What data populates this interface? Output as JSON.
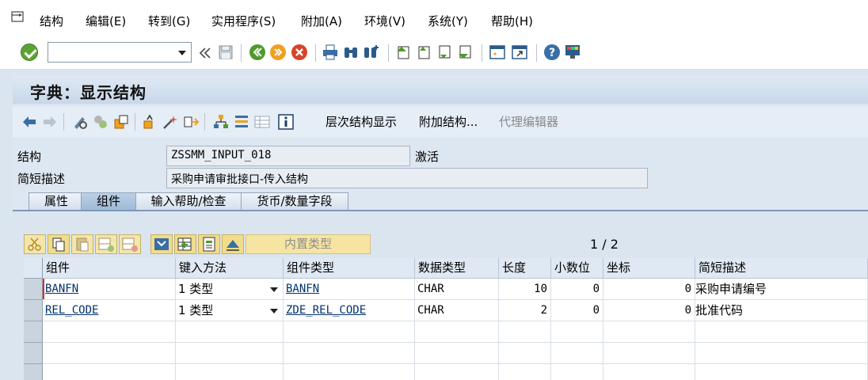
{
  "menu": {
    "items": [
      "结构",
      "编辑(E)",
      "转到(G)",
      "实用程序(S)",
      "附加(A)",
      "环境(V)",
      "系统(Y)",
      "帮助(H)"
    ]
  },
  "std_toolbar": {
    "command_value": ""
  },
  "title": "字典：显示结构",
  "app_toolbar": {
    "hier_display": "层次结构显示",
    "append_struct": "附加结构...",
    "proxy_editor": "代理编辑器"
  },
  "fields": {
    "struct_label": "结构",
    "struct_value": "ZSSMM_INPUT_018",
    "status": "激活",
    "desc_label": "简短描述",
    "desc_value": "采购申请审批接口-传入结构"
  },
  "tabs": [
    "属性",
    "组件",
    "输入帮助/检查",
    "货币/数量字段"
  ],
  "grid_toolbar": {
    "builtin_type": "内置类型",
    "page": "1 / 2"
  },
  "table": {
    "headers": [
      "组件",
      "键入方法",
      "组件类型",
      "数据类型",
      "长度",
      "小数位",
      "坐标",
      "简短描述"
    ],
    "rows": [
      [
        "BANFN",
        "1 类型",
        "BANFN",
        "CHAR",
        "10",
        "0",
        "0",
        "采购申请编号"
      ],
      [
        "REL_CODE",
        "1 类型",
        "ZDE_REL_CODE",
        "CHAR",
        "2",
        "0",
        "0",
        "批准代码"
      ]
    ]
  },
  "colors": {
    "ok_green": "#5da334",
    "title_bg": "#c8d8ea",
    "button_yellow": "#f1dc8a",
    "link_blue": "#00336e"
  }
}
